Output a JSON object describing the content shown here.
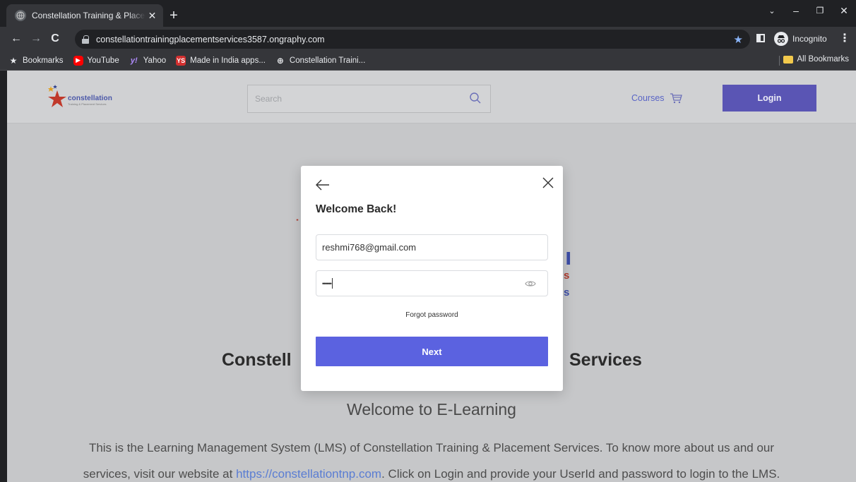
{
  "browser": {
    "tab_title": "Constellation Training & Placeme",
    "url": "constellationtrainingplacementservices3587.ongraphy.com",
    "incognito_label": "Incognito",
    "bookmarks": [
      {
        "label": "Bookmarks",
        "icon": "star-icon"
      },
      {
        "label": "YouTube",
        "icon": "youtube-icon"
      },
      {
        "label": "Yahoo",
        "icon": "yahoo-icon"
      },
      {
        "label": "Made in India apps...",
        "icon": "ys-icon"
      },
      {
        "label": "Constellation Traini...",
        "icon": "globe-icon"
      }
    ],
    "all_bookmarks_label": "All Bookmarks"
  },
  "site": {
    "logo_text": "constellation",
    "logo_subtext": "Training & Placement Services",
    "search_placeholder": "Search",
    "courses_label": "Courses",
    "login_label": "Login"
  },
  "hero": {
    "title_left": "Constell",
    "title_right": "Services",
    "subtitle": "Welcome to E-Learning",
    "paragraph_line1": "This is the Learning Management System (LMS) of Constellation Training & Placement Services. To know more about us and our",
    "paragraph_line2_before": "services, visit our website at ",
    "paragraph_link": "https://constellationtnp.com",
    "paragraph_line2_after": ". Click on Login and provide your UserId and password to login to the LMS."
  },
  "modal": {
    "title": "Welcome Back!",
    "email_value": "reshmi768@gmail.com",
    "password_mask": "••••••",
    "forgot_label": "Forgot password",
    "next_label": "Next"
  },
  "colors": {
    "accent": "#5b62e0",
    "login_button": "#5a55b4",
    "link": "#5a7dd3"
  }
}
